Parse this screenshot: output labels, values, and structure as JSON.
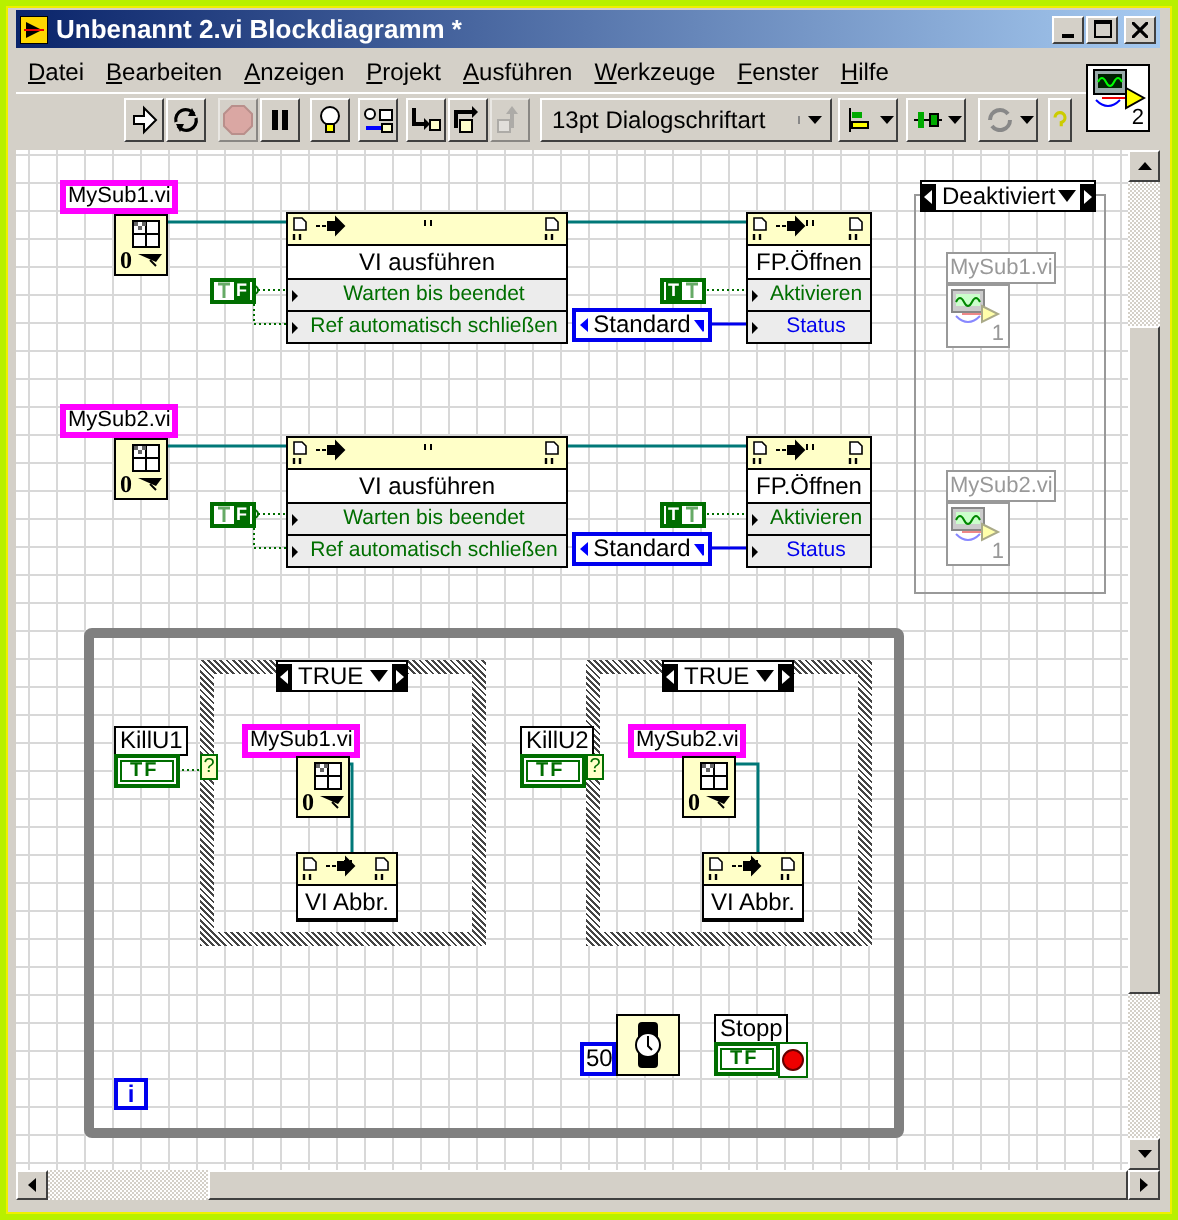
{
  "window": {
    "title": "Unbenannt 2.vi Blockdiagramm *"
  },
  "menu": [
    "Datei",
    "Bearbeiten",
    "Anzeigen",
    "Projekt",
    "Ausführen",
    "Werkzeuge",
    "Fenster",
    "Hilfe"
  ],
  "toolbar": {
    "buttons": [
      {
        "kind": "run",
        "disabled": false
      },
      {
        "kind": "run_continuously",
        "disabled": false
      },
      {
        "kind": "abort",
        "disabled": true
      },
      {
        "kind": "pause",
        "disabled": false
      },
      {
        "kind": "highlight",
        "disabled": false
      },
      {
        "kind": "retain",
        "disabled": false
      },
      {
        "kind": "step_into",
        "disabled": false
      },
      {
        "kind": "step_over",
        "disabled": false
      },
      {
        "kind": "step_out",
        "disabled": true
      },
      {
        "kind": "font",
        "label": "13pt Dialogschriftart",
        "disabled": false
      },
      {
        "kind": "align",
        "disabled": false
      },
      {
        "kind": "distribute",
        "disabled": false
      },
      {
        "kind": "reorder",
        "disabled": false
      },
      {
        "kind": "help",
        "disabled": false
      }
    ]
  },
  "vi_icon": {
    "number": "2"
  },
  "diagram": {
    "launch_rows": [
      {
        "vi_label": "MySub1.vi",
        "ref_index": "0",
        "wait_constant": {
          "label": "F",
          "value": false
        },
        "run_node": {
          "title": "VI ausführen",
          "properties": [
            {
              "name": "Warten bis beendet",
              "kind": "boolean"
            },
            {
              "name": "Ref automatisch schließen",
              "kind": "boolean"
            }
          ]
        },
        "activate_constant": {
          "label": "T",
          "value": true
        },
        "state_enum": "Standard",
        "open_node": {
          "title": "FP.Öffnen",
          "properties": [
            {
              "name": "Aktivieren",
              "kind": "boolean"
            },
            {
              "name": "Status",
              "kind": "enum"
            }
          ]
        }
      },
      {
        "vi_label": "MySub2.vi",
        "ref_index": "0",
        "wait_constant": {
          "label": "F",
          "value": false
        },
        "run_node": {
          "title": "VI ausführen",
          "properties": [
            {
              "name": "Warten bis beendet",
              "kind": "boolean"
            },
            {
              "name": "Ref automatisch schließen",
              "kind": "boolean"
            }
          ]
        },
        "activate_constant": {
          "label": "T",
          "value": true
        },
        "state_enum": "Standard",
        "open_node": {
          "title": "FP.Öffnen",
          "properties": [
            {
              "name": "Aktivieren",
              "kind": "boolean"
            },
            {
              "name": "Status",
              "kind": "enum"
            }
          ]
        }
      }
    ],
    "disabled_structure": {
      "selector": "Deaktiviert",
      "subvis": [
        {
          "label": "MySub1.vi",
          "number": "1"
        },
        {
          "label": "MySub2.vi",
          "number": "1"
        }
      ]
    },
    "while_loop": {
      "cases": [
        {
          "control_label": "KillU1",
          "control_text": "TF",
          "tunnel": "?",
          "selector": "TRUE",
          "vi_label": "MySub1.vi",
          "ref_index": "0",
          "abort_node": "VI Abbr."
        },
        {
          "control_label": "KillU2",
          "control_text": "TF",
          "tunnel": "?",
          "selector": "TRUE",
          "vi_label": "MySub2.vi",
          "ref_index": "0",
          "abort_node": "VI Abbr."
        }
      ],
      "wait_ms": "50",
      "stop_label": "Stopp",
      "stop_text": "TF",
      "iteration": "i"
    }
  }
}
